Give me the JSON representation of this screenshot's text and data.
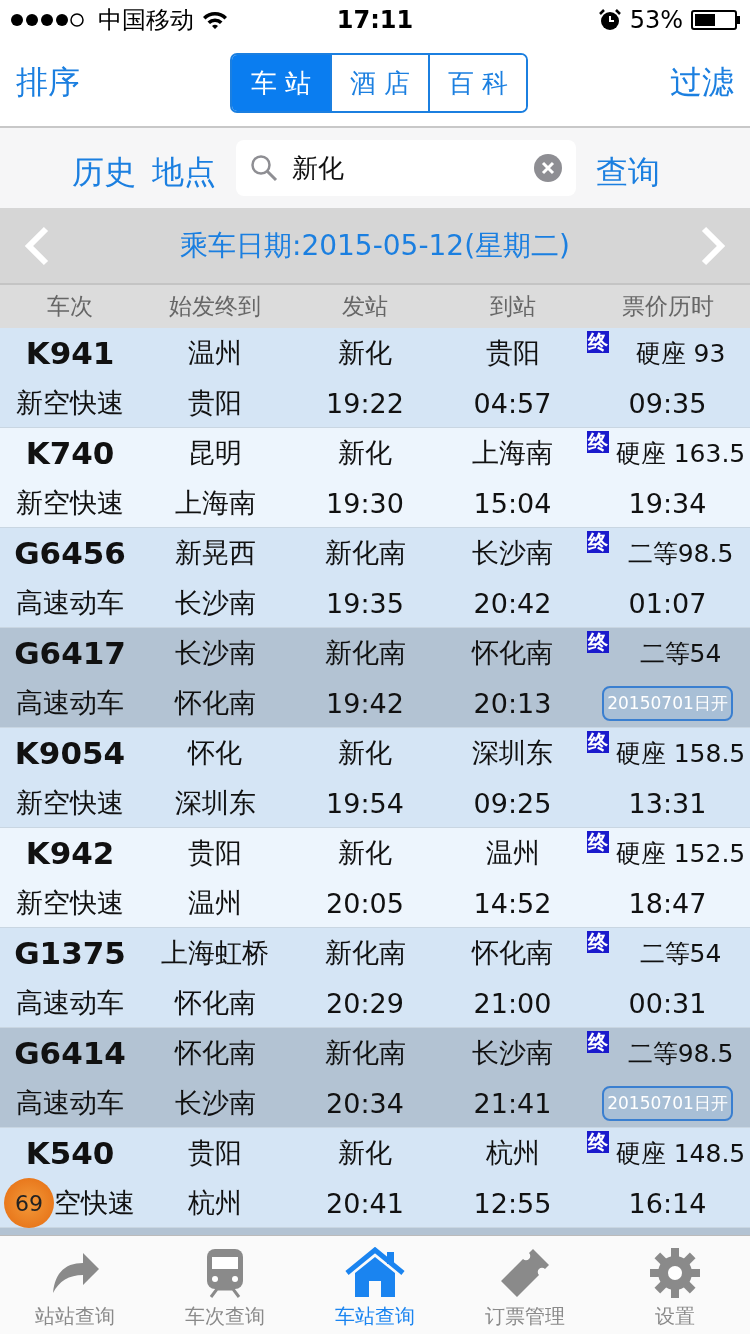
{
  "status_bar": {
    "carrier": "中国移动",
    "time": "17:11",
    "battery_text": "53%"
  },
  "nav": {
    "left": "排序",
    "right": "过滤",
    "segments": [
      {
        "label": "车 站",
        "selected": true
      },
      {
        "label": "酒 店",
        "selected": false
      },
      {
        "label": "百 科",
        "selected": false
      }
    ]
  },
  "search": {
    "history": "历史",
    "place": "地点",
    "value": "新化",
    "submit": "查询"
  },
  "date_bar": {
    "label": "乘车日期:2015-05-12(星期二)"
  },
  "table": {
    "columns": [
      "车次",
      "始发终到",
      "发站",
      "到站",
      "票价历时"
    ],
    "rows": [
      {
        "selected": false,
        "train": "K941",
        "type": "新空快速",
        "origin": "温州",
        "dest": "贵阳",
        "from": "新化",
        "depart": "19:22",
        "to": "贵阳",
        "arrive": "04:57",
        "mark": "终",
        "price": "硬座 93",
        "duration": "09:35"
      },
      {
        "selected": false,
        "train": "K740",
        "type": "新空快速",
        "origin": "昆明",
        "dest": "上海南",
        "from": "新化",
        "depart": "19:30",
        "to": "上海南",
        "arrive": "15:04",
        "mark": "终",
        "price": "硬座 163.5",
        "duration": "19:34"
      },
      {
        "selected": false,
        "train": "G6456",
        "type": "高速动车",
        "origin": "新晃西",
        "dest": "长沙南",
        "from": "新化南",
        "depart": "19:35",
        "to": "长沙南",
        "arrive": "20:42",
        "mark": "终",
        "price": "二等98.5",
        "duration": "01:07"
      },
      {
        "selected": true,
        "train": "G6417",
        "type": "高速动车",
        "origin": "长沙南",
        "dest": "怀化南",
        "from": "新化南",
        "depart": "19:42",
        "to": "怀化南",
        "arrive": "20:13",
        "mark": "终",
        "price": "二等54",
        "note": "20150701日开"
      },
      {
        "selected": false,
        "train": "K9054",
        "type": "新空快速",
        "origin": "怀化",
        "dest": "深圳东",
        "from": "新化",
        "depart": "19:54",
        "to": "深圳东",
        "arrive": "09:25",
        "mark": "终",
        "price": "硬座 158.5",
        "duration": "13:31"
      },
      {
        "selected": false,
        "train": "K942",
        "type": "新空快速",
        "origin": "贵阳",
        "dest": "温州",
        "from": "新化",
        "depart": "20:05",
        "to": "温州",
        "arrive": "14:52",
        "mark": "终",
        "price": "硬座 152.5",
        "duration": "18:47"
      },
      {
        "selected": false,
        "train": "G1375",
        "type": "高速动车",
        "origin": "上海虹桥",
        "dest": "怀化南",
        "from": "新化南",
        "depart": "20:29",
        "to": "怀化南",
        "arrive": "21:00",
        "mark": "终",
        "price": "二等54",
        "duration": "00:31"
      },
      {
        "selected": true,
        "train": "G6414",
        "type": "高速动车",
        "origin": "怀化南",
        "dest": "长沙南",
        "from": "新化南",
        "depart": "20:34",
        "to": "长沙南",
        "arrive": "21:41",
        "mark": "终",
        "price": "二等98.5",
        "note": "20150701日开"
      },
      {
        "selected": false,
        "train": "K540",
        "type": "空快速",
        "badge": "69",
        "origin": "贵阳",
        "dest": "杭州",
        "from": "新化",
        "depart": "20:41",
        "to": "杭州",
        "arrive": "12:55",
        "mark": "终",
        "price": "硬座 148.5",
        "duration": "16:14"
      }
    ]
  },
  "tab_bar": [
    {
      "label": "站站查询",
      "selected": false
    },
    {
      "label": "车次查询",
      "selected": false
    },
    {
      "label": "车站查询",
      "selected": true
    },
    {
      "label": "订票管理",
      "selected": false
    },
    {
      "label": "设置",
      "selected": false
    }
  ]
}
